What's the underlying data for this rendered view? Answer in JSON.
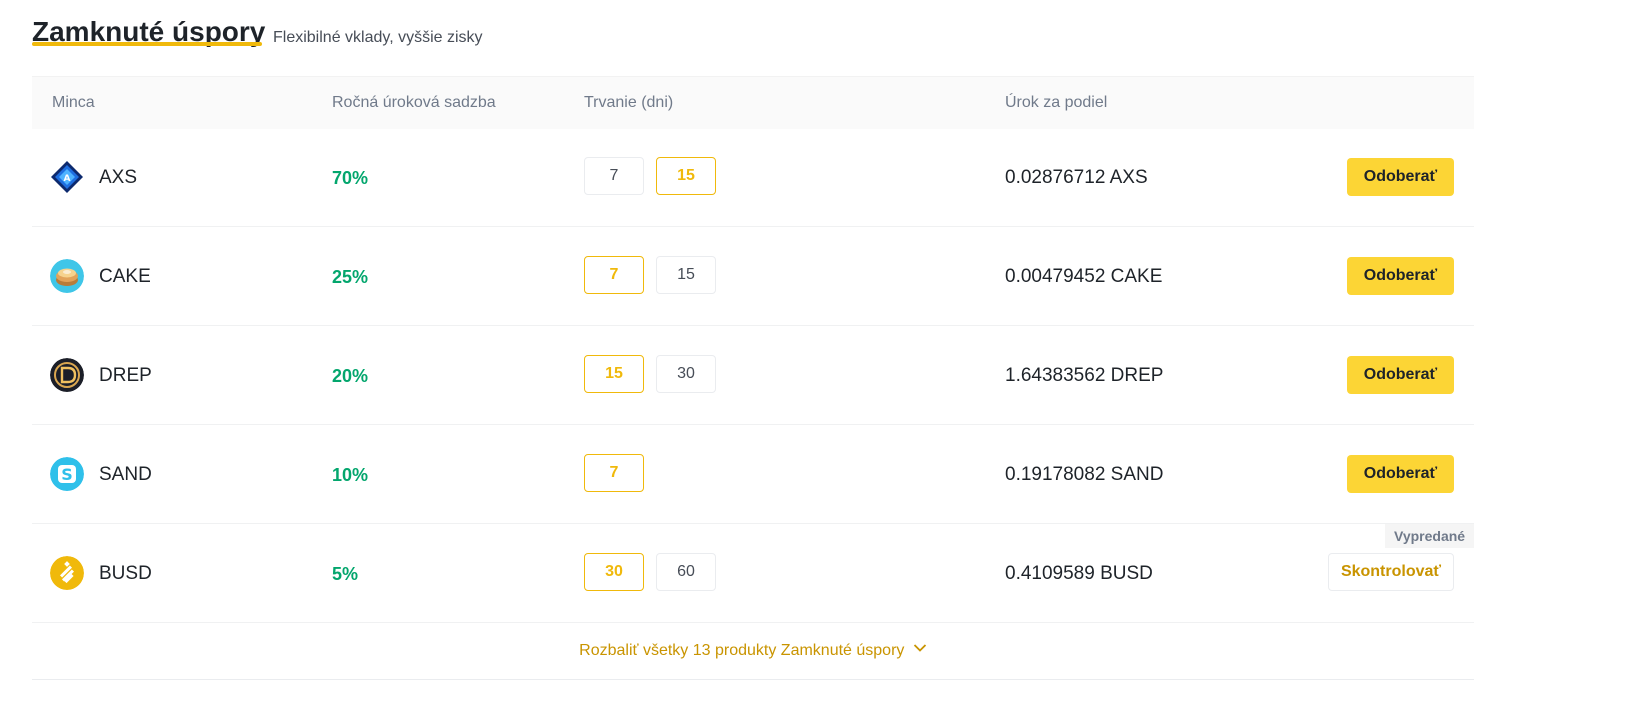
{
  "header": {
    "title": "Zamknuté úspory",
    "subtitle": "Flexibilné vklady, vyššie zisky"
  },
  "columns": {
    "coin": "Minca",
    "rate": "Ročná úroková sadzba",
    "duration": "Trvanie (dni)",
    "interest": "Úrok za podiel"
  },
  "rows": [
    {
      "coin": "AXS",
      "icon": "axs-coin-icon",
      "rate": "70%",
      "durations": [
        "7",
        "15"
      ],
      "selected_duration": "15",
      "interest": "0.02876712 AXS",
      "action": "Odoberať"
    },
    {
      "coin": "CAKE",
      "icon": "cake-coin-icon",
      "rate": "25%",
      "durations": [
        "7",
        "15"
      ],
      "selected_duration": "7",
      "interest": "0.00479452 CAKE",
      "action": "Odoberať"
    },
    {
      "coin": "DREP",
      "icon": "drep-coin-icon",
      "rate": "20%",
      "durations": [
        "15",
        "30"
      ],
      "selected_duration": "15",
      "interest": "1.64383562 DREP",
      "action": "Odoberať"
    },
    {
      "coin": "SAND",
      "icon": "sand-coin-icon",
      "rate": "10%",
      "durations": [
        "7"
      ],
      "selected_duration": "7",
      "interest": "0.19178082 SAND",
      "action": "Odoberať"
    },
    {
      "coin": "BUSD",
      "icon": "busd-coin-icon",
      "rate": "5%",
      "durations": [
        "30",
        "60"
      ],
      "selected_duration": "30",
      "interest": "0.4109589 BUSD",
      "action": "Skontrolovať",
      "badge": "Vypredané"
    }
  ],
  "expand": {
    "label": "Rozbaliť všetky 13 produkty Zamknuté úspory",
    "icon": "chevron-down-icon"
  },
  "colors": {
    "accent": "#f0b90b",
    "primary_button": "#fcd535",
    "positive": "#03a66d",
    "link": "#c99400"
  }
}
